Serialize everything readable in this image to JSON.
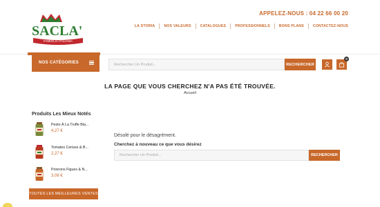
{
  "brand": {
    "logo_text": "SACLA'",
    "logo_tagline": "FAMIGLIA ITALIANA"
  },
  "header": {
    "phone_label": "APPELEZ-NOUS : 04 22 66 00 20",
    "nav": [
      {
        "label": "LA STORIA"
      },
      {
        "label": "NOS VALEURS"
      },
      {
        "label": "CATALOGUES"
      },
      {
        "label": "PROFESSIONNELS"
      },
      {
        "label": "BONS PLANS"
      },
      {
        "label": "CONTACTEZ-NOUS"
      }
    ],
    "categories_label": "NOS CATÉGORIES",
    "search_placeholder": "Rechercher Un Produit...",
    "search_button": "RECHERCHER",
    "cart_count": "0"
  },
  "notfound": {
    "title": "LA PAGE QUE VOUS CHERCHEZ N'A PAS ÉTÉ TROUVÉE.",
    "breadcrumb": "Accueil",
    "sorry": "Désolé pour le désagrément.",
    "search_again": "Cherchez à nouveau ce que vous désirez",
    "search_placeholder": "Rechercher Un Produit...",
    "search_button": "RECHERCHER"
  },
  "sidebar": {
    "title": "Produits Les Mieux Notés",
    "products": [
      {
        "name": "Pesto À La Truffe Bla...",
        "price": "4,27 €"
      },
      {
        "name": "Tomates Cerises & B...",
        "price": "2,27 €"
      },
      {
        "name": "Poivrons Figues & N...",
        "price": "3,08 €"
      }
    ],
    "all_button": "TOUTES LES MEILLEURES VENTES"
  },
  "colors": {
    "accent": "#c8682a",
    "logo_red": "#c1272d",
    "logo_green": "#2e7d32"
  }
}
